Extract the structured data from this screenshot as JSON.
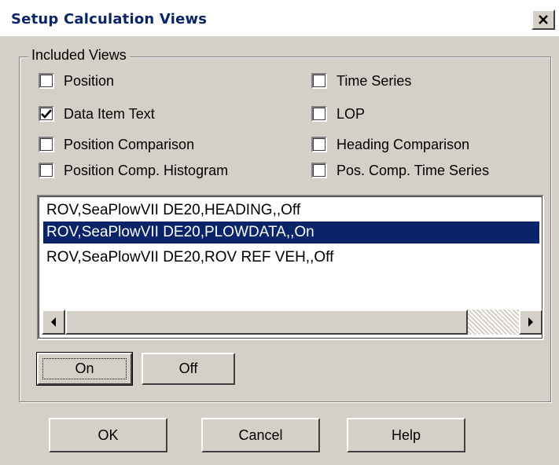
{
  "dialog": {
    "title": "Setup Calculation Views",
    "close_glyph": "✕"
  },
  "group": {
    "label": "Included Views",
    "checkboxes_left": [
      {
        "label": "Position",
        "checked": false
      },
      {
        "label": "Data Item Text",
        "checked": true
      },
      {
        "label": "Position Comparison",
        "checked": false
      },
      {
        "label": "Position Comp. Histogram",
        "checked": false
      }
    ],
    "checkboxes_right": [
      {
        "label": "Time Series",
        "checked": false
      },
      {
        "label": "LOP",
        "checked": false
      },
      {
        "label": "Heading Comparison",
        "checked": false
      },
      {
        "label": "Pos. Comp. Time Series",
        "checked": false
      }
    ],
    "list_items": [
      {
        "text": "ROV,SeaPlowVII DE20,HEADING,,Off",
        "selected": false
      },
      {
        "text": "ROV,SeaPlowVII DE20,PLOWDATA,,On",
        "selected": true
      },
      {
        "text": "ROV,SeaPlowVII DE20,ROV REF VEH,,Off",
        "selected": false
      }
    ],
    "on_button": "On",
    "off_button": "Off"
  },
  "footer": {
    "ok": "OK",
    "cancel": "Cancel",
    "help": "Help"
  },
  "icons": {
    "checkmark": "check-icon",
    "scroll_left": "arrow-left-icon",
    "scroll_right": "arrow-right-icon",
    "close": "close-icon"
  },
  "colors": {
    "title_text": "#0a246a",
    "selection": "#0a246a",
    "face": "#d4d0c8"
  }
}
